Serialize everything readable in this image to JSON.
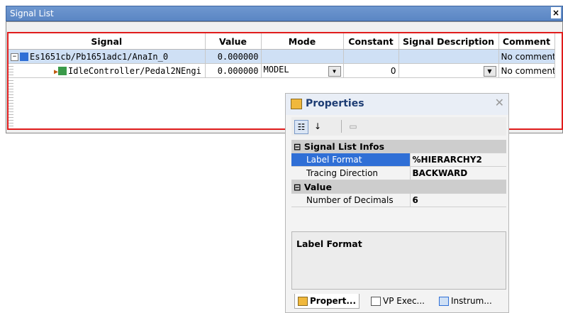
{
  "window": {
    "title": "Signal List",
    "close_label": "×"
  },
  "grid": {
    "columns": [
      "Signal",
      "Value",
      "Mode",
      "Constant",
      "Signal Description",
      "Comment"
    ],
    "rows": [
      {
        "signal": "Es1651cb/Pb1651adc1/AnaIn_0",
        "value": "0.000000",
        "mode": "",
        "constant": "",
        "description": "",
        "comment": "No comment"
      },
      {
        "signal": "IdleController/Pedal2NEngi",
        "value": "0.000000",
        "mode": "MODEL",
        "constant": "0",
        "description": "",
        "comment": "No comment"
      }
    ]
  },
  "properties": {
    "title": "Properties",
    "categories": [
      {
        "name": "Signal List Infos",
        "items": [
          {
            "key": "Label Format",
            "value": "%HIERARCHY2"
          },
          {
            "key": "Tracing Direction",
            "value": "BACKWARD"
          }
        ]
      },
      {
        "name": "Value",
        "items": [
          {
            "key": "Number of Decimals",
            "value": "6"
          }
        ]
      }
    ],
    "description_title": "Label Format",
    "tabs": [
      "Propert...",
      "VP Exec...",
      "Instrum..."
    ]
  }
}
